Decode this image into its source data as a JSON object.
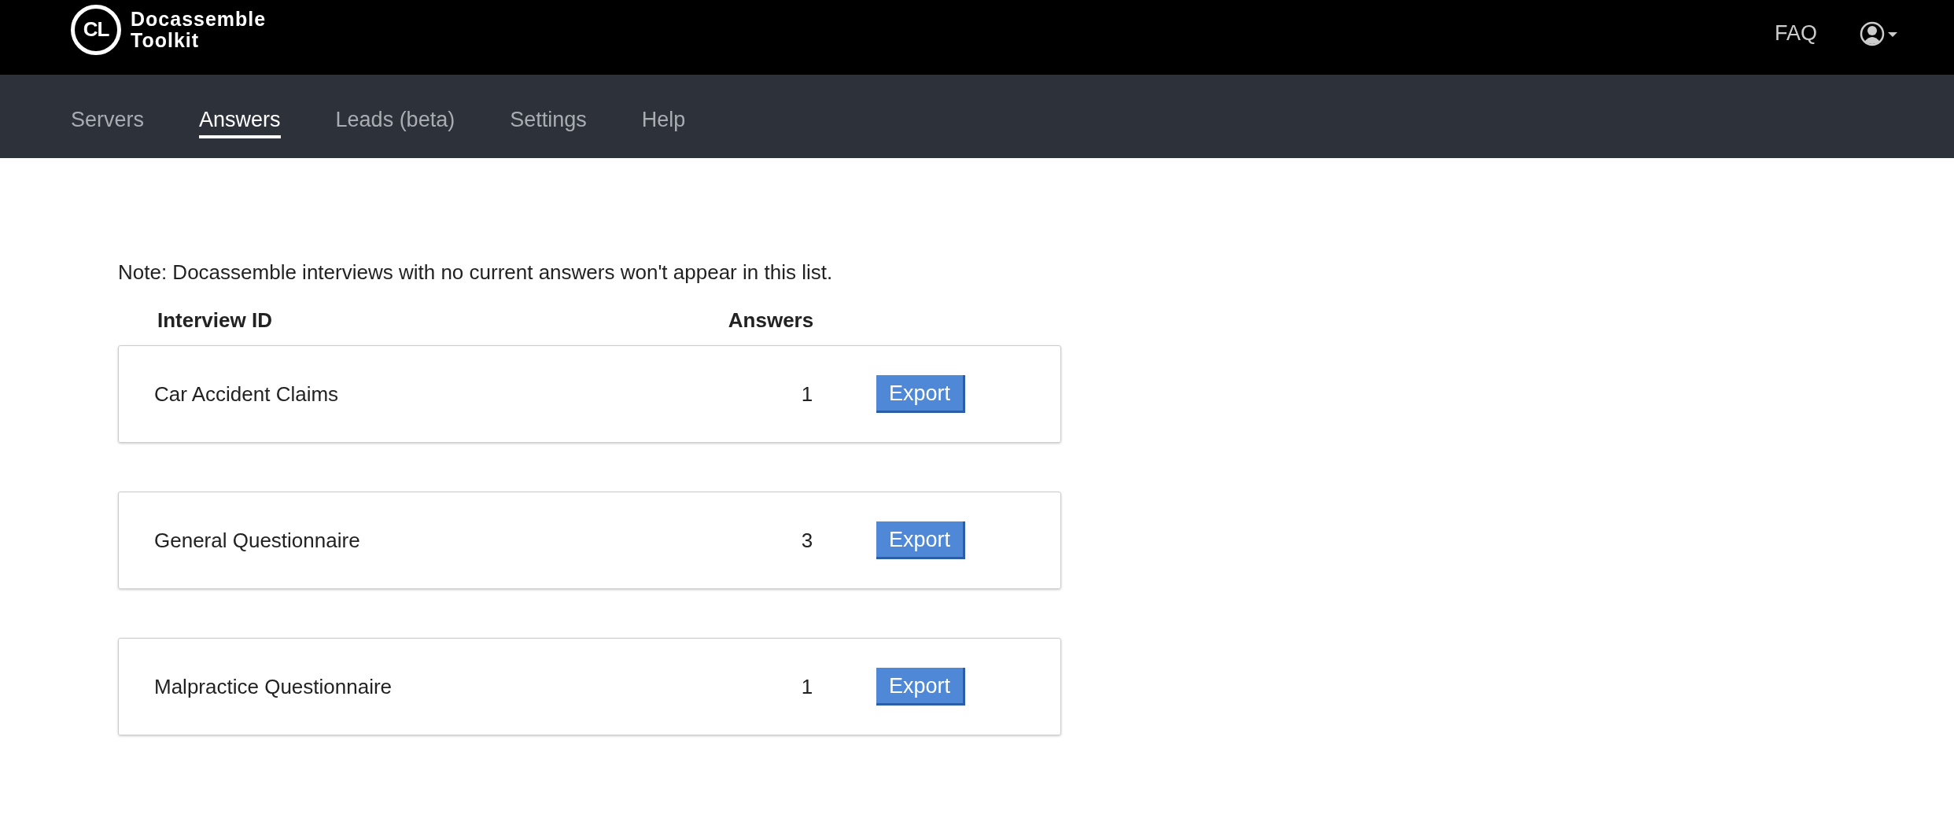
{
  "brand": {
    "line_1": "Docassemble",
    "line_2": "Toolkit",
    "logo_text": "CL"
  },
  "top_links": [
    {
      "label": "FAQ"
    }
  ],
  "nav": [
    {
      "label": "Servers",
      "selected": false
    },
    {
      "label": "Answers",
      "selected": true
    },
    {
      "label": "Leads (beta)",
      "selected": false
    },
    {
      "label": "Settings",
      "selected": false
    },
    {
      "label": "Help",
      "selected": false
    }
  ],
  "note": "Note: Docassemble interviews with no current answers won't appear in this list.",
  "table": {
    "columns": [
      "Interview ID",
      "Answers"
    ],
    "rows": [
      {
        "interview_id": "Car Accident Claims",
        "answers": "1",
        "action": "Export"
      },
      {
        "interview_id": "General Questionnaire",
        "answers": "3",
        "action": "Export"
      },
      {
        "interview_id": "Malpractice Questionnaire",
        "answers": "1",
        "action": "Export"
      }
    ]
  }
}
